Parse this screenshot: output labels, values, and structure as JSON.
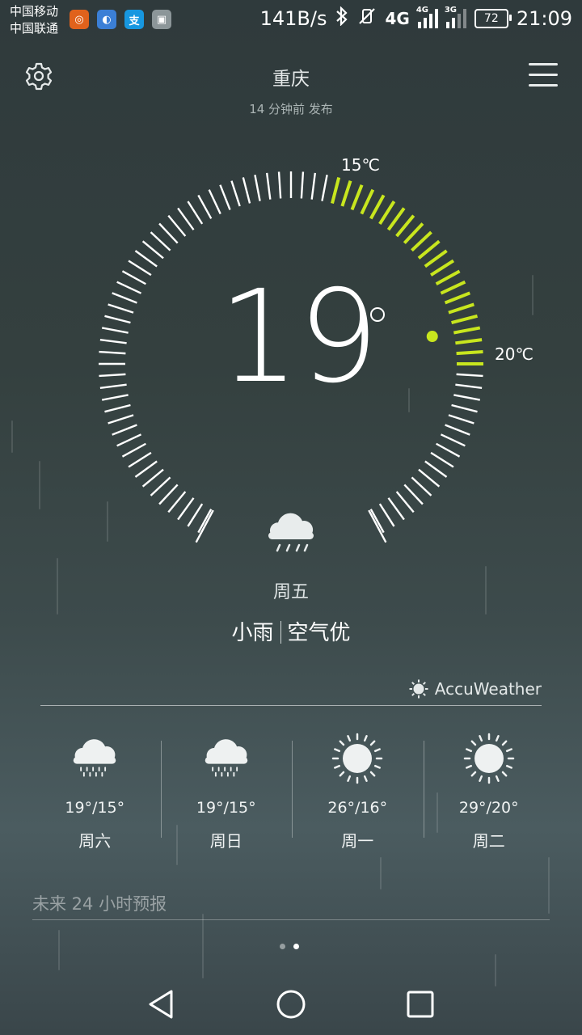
{
  "status_bar": {
    "carrier_1": "中国移动",
    "carrier_2": "中国联通",
    "network_speed": "141B/s",
    "network_1": "4G",
    "network_2": "3G",
    "battery": "72",
    "time": "21:09"
  },
  "header": {
    "city": "重庆",
    "published": "14 分钟前 发布"
  },
  "dial": {
    "label_low": "15℃",
    "label_high": "20℃",
    "current_temp": "19",
    "accent_color": "#c8e61e"
  },
  "today": {
    "weekday": "周五",
    "condition": "小雨",
    "air_quality": "空气优"
  },
  "provider": "AccuWeather",
  "forecast": [
    {
      "range": "19°/15°",
      "day": "周六",
      "icon": "rain-icon"
    },
    {
      "range": "19°/15°",
      "day": "周日",
      "icon": "rain-icon"
    },
    {
      "range": "26°/16°",
      "day": "周一",
      "icon": "sun-icon"
    },
    {
      "range": "29°/20°",
      "day": "周二",
      "icon": "sun-icon"
    }
  ],
  "future_label": "未来 24 小时预报",
  "pager": {
    "pages": 2,
    "active": 2
  }
}
